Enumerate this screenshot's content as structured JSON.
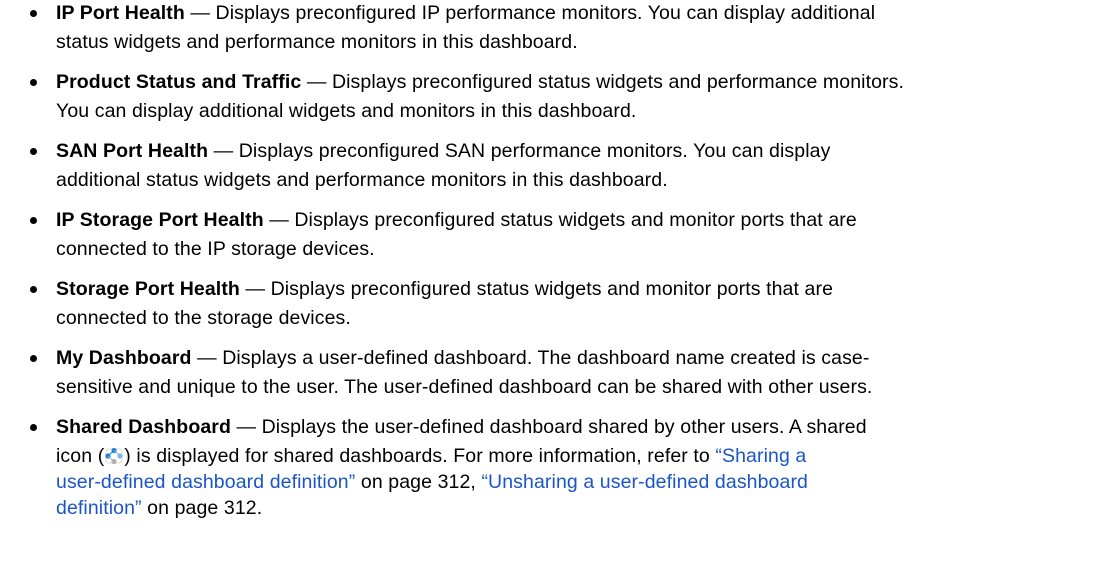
{
  "items": [
    {
      "term": "IP Port Health",
      "line1": " — Displays preconfigured IP performance monitors. You can display additional",
      "line2": "status widgets and performance monitors in this dashboard."
    },
    {
      "term": "Product Status and Traffic",
      "line1": " — Displays preconfigured status widgets and performance monitors.",
      "line2": "You can display additional widgets and monitors in this dashboard."
    },
    {
      "term": "SAN Port Health",
      "line1": " — Displays preconfigured SAN performance monitors. You can display",
      "line2": "additional status widgets and performance monitors in this dashboard."
    },
    {
      "term": "IP Storage Port Health",
      "line1": " — Displays preconfigured status widgets and monitor ports that are",
      "line2": "connected to the IP storage devices."
    },
    {
      "term": "Storage Port Health",
      "line1": " — Displays preconfigured status widgets and monitor ports that are",
      "line2": "connected to the storage devices."
    },
    {
      "term": "My Dashboard",
      "line1": " — Displays a user-defined dashboard. The dashboard name created is case-",
      "line2": "sensitive and unique to the user. The user-defined dashboard can be shared with other users."
    },
    {
      "term": "Shared Dashboard",
      "line1": " — Displays the user-defined dashboard shared by other users. A shared",
      "line2_pre": "icon (",
      "line2_post": ") is displayed for shared dashboards. For more information, refer to ",
      "link1_part1": "“Sharing a",
      "link1_part2": "user-defined dashboard definition”",
      "mid1": " on page 312, ",
      "link2_part1": "“Unsharing a user-defined dashboard",
      "link2_part2": "definition”",
      "tail": " on page 312."
    }
  ],
  "icons": {
    "shared_icon": "shared-dashboard-icon",
    "link_color": "#1a55c8",
    "icon_blue": "#1f7fd6",
    "icon_gray": "#b0b0b0"
  }
}
